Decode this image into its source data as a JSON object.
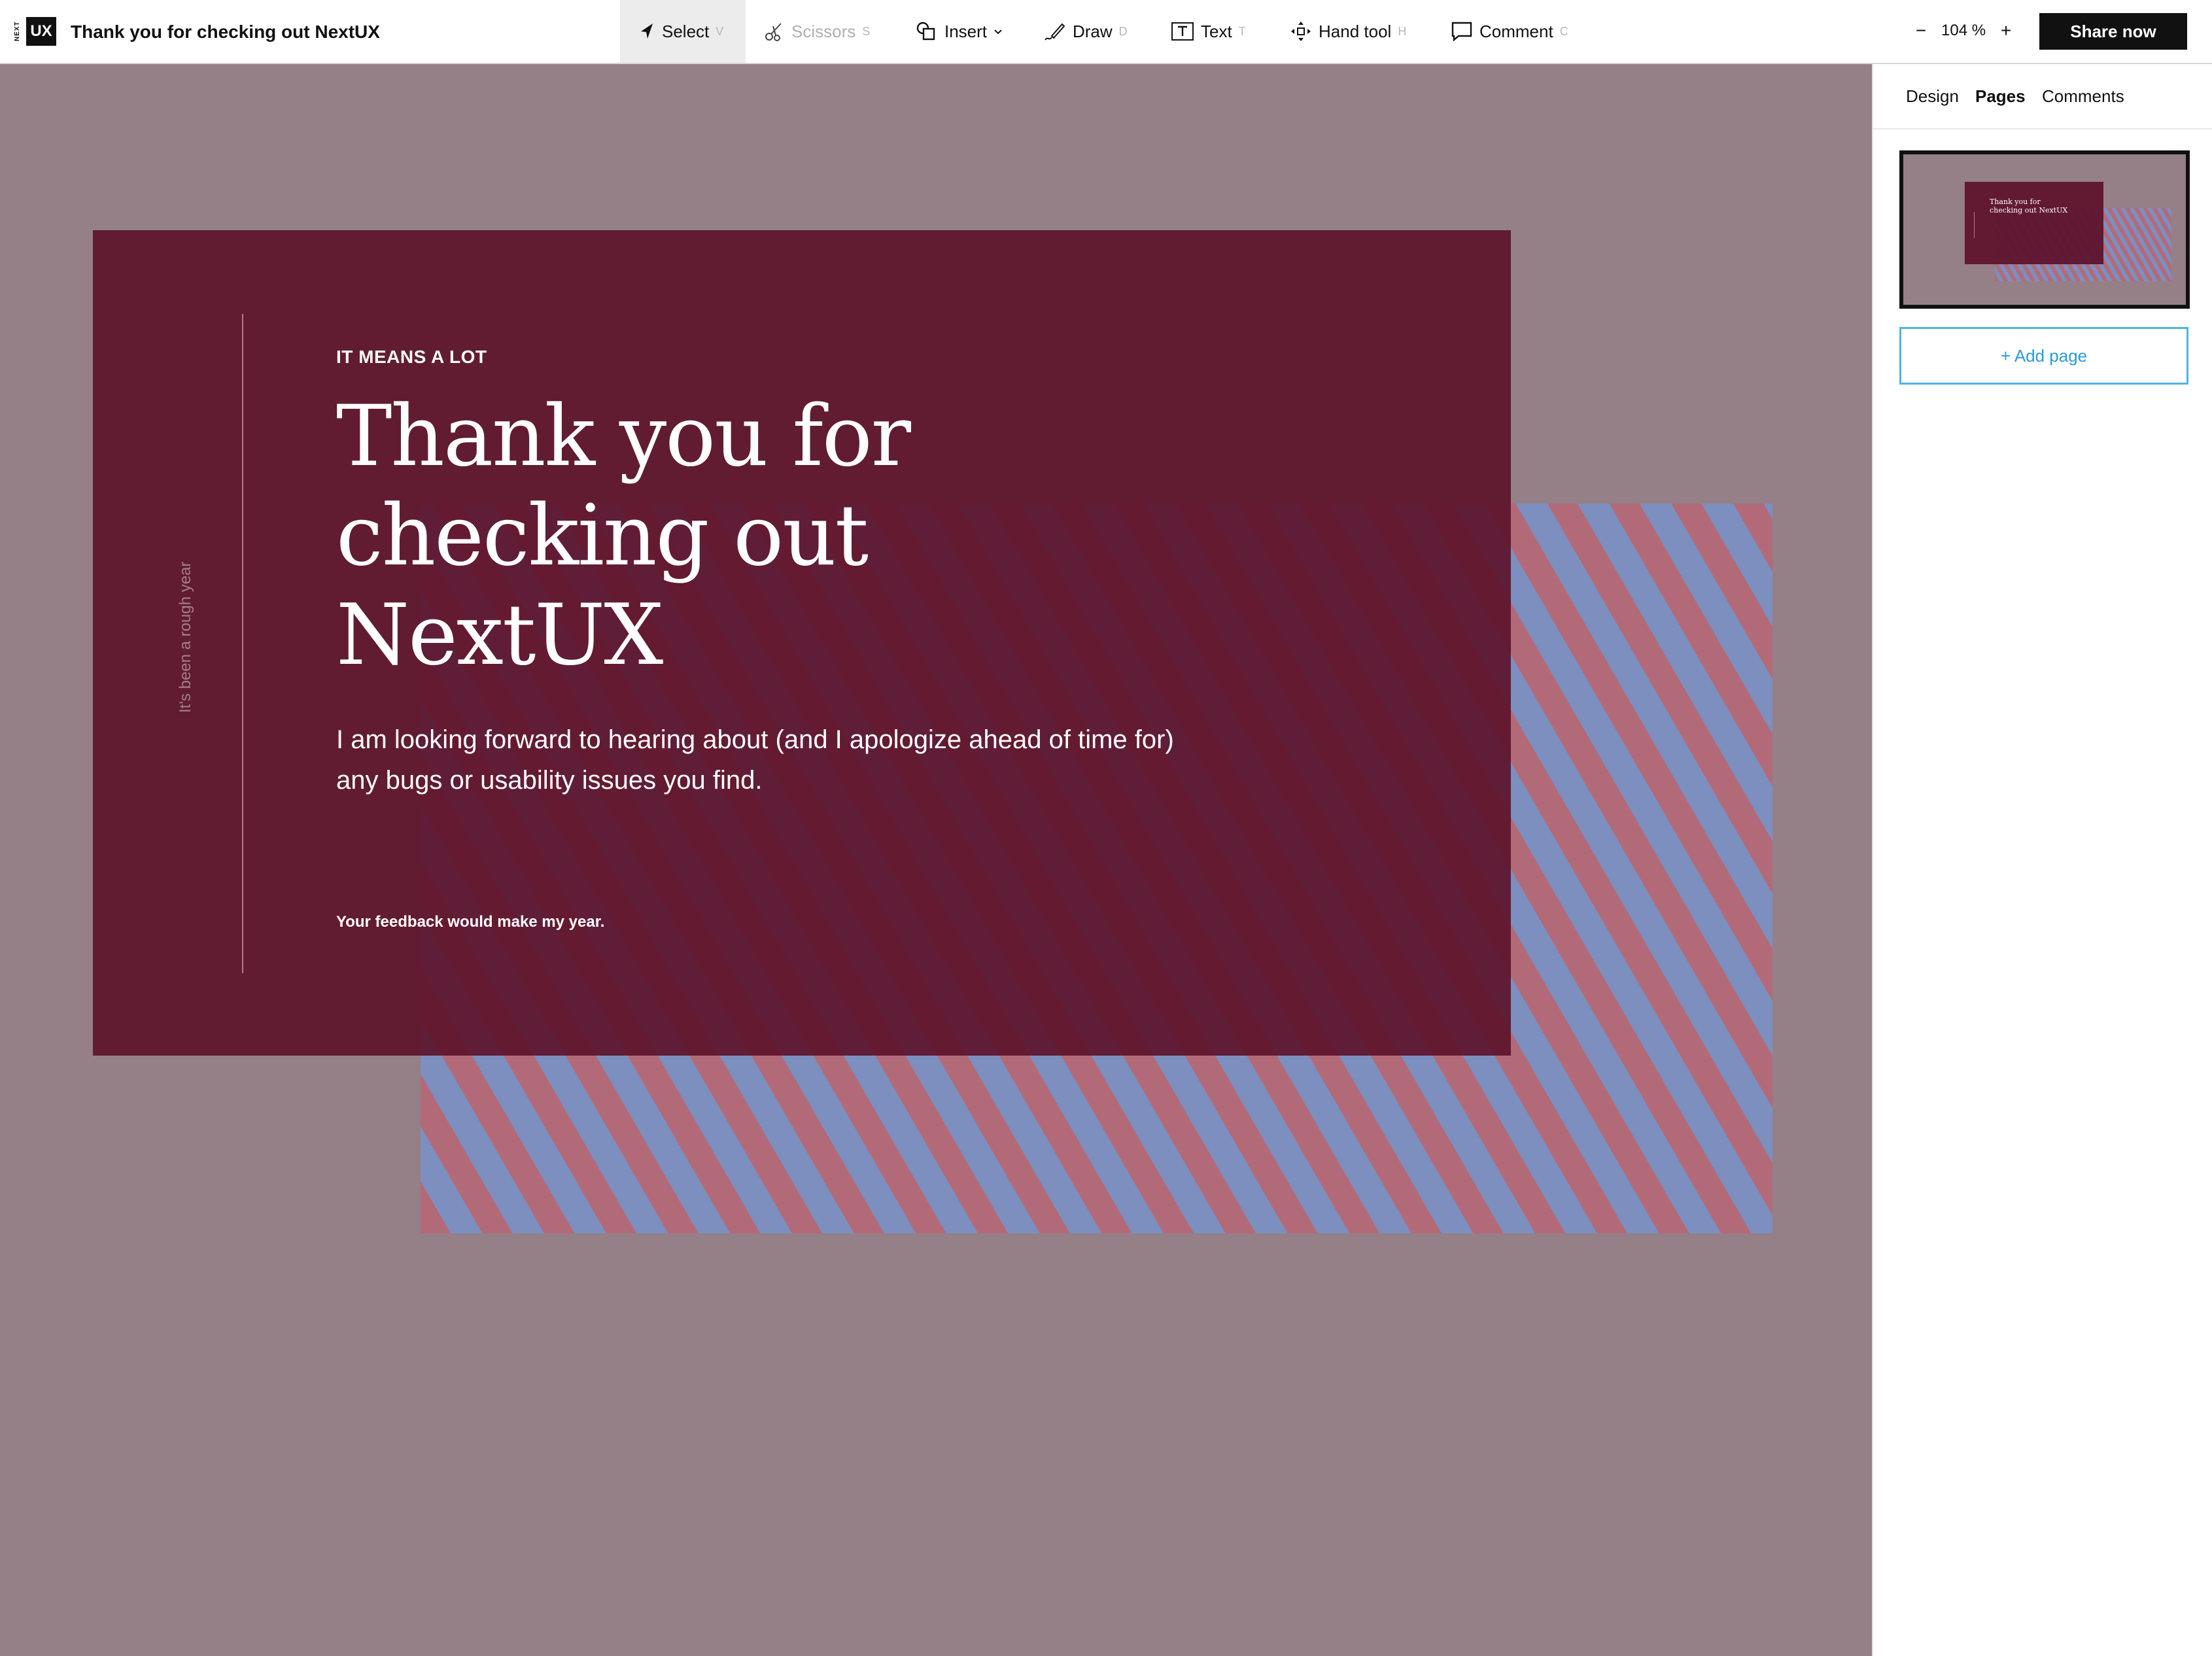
{
  "app": {
    "logo": {
      "small": "NEXT",
      "main": "UX"
    },
    "document_title": "Thank you for checking out NextUX"
  },
  "toolbar": {
    "tools": [
      {
        "label": "Select",
        "shortcut": "V",
        "icon": "cursor-icon",
        "active": true
      },
      {
        "label": "Scissors",
        "shortcut": "S",
        "icon": "scissors-icon",
        "disabled": true
      },
      {
        "label": "Insert",
        "icon": "shape-icon",
        "dropdown": true
      },
      {
        "label": "Draw",
        "shortcut": "D",
        "icon": "pencil-icon"
      },
      {
        "label": "Text",
        "shortcut": "T",
        "icon": "text-box-icon"
      },
      {
        "label": "Hand tool",
        "shortcut": "H",
        "icon": "hand-move-icon"
      },
      {
        "label": "Comment",
        "shortcut": "C",
        "icon": "comment-icon"
      }
    ],
    "zoom": {
      "minus": "−",
      "value": "104 %",
      "plus": "+"
    },
    "share_label": "Share now"
  },
  "slide": {
    "side_text": "It's been a rough year",
    "eyebrow": "IT MEANS A LOT",
    "headline_lines": [
      "Thank you for",
      "checking out",
      "NextUX"
    ],
    "body_lines": [
      "I am looking forward to hearing about (and I apologize ahead of time for)",
      "any bugs or usability issues you find."
    ],
    "footnote": "Your feedback would make my year."
  },
  "panel": {
    "tabs": [
      {
        "label": "Design",
        "active": false
      },
      {
        "label": "Pages",
        "active": true
      },
      {
        "label": "Comments",
        "active": false
      }
    ],
    "thumbnail": {
      "headline": "Thank you for checking out NextUX"
    },
    "add_page_label": "+ Add page"
  },
  "colors": {
    "canvas": "#948086",
    "slide": "#5e142c",
    "stripe_pink": "#b26a79",
    "stripe_blue": "#7c8fbe",
    "accent_blue": "#2a9bd6",
    "share_button": "#111111"
  }
}
